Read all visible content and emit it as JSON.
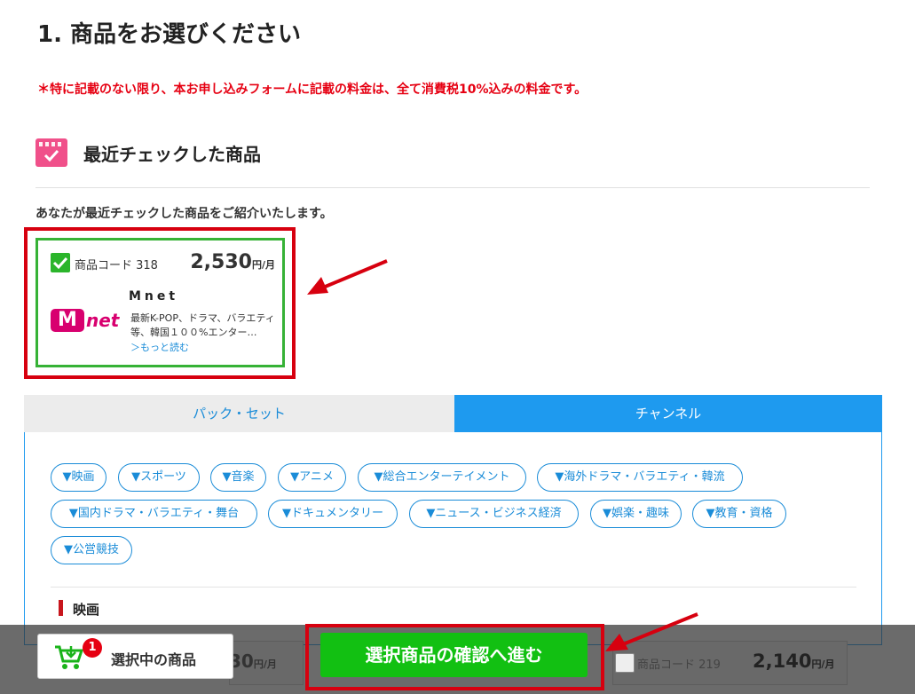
{
  "heading": {
    "step_title": "1. 商品をお選びください"
  },
  "notice": "＊特に記載のない限り、本お申し込みフォームに記載の料金は、全て消費税10%込みの料金です。",
  "recent": {
    "title": "最近チェックした商品",
    "description": "あなたが最近チェックした商品をご紹介いたします。",
    "item": {
      "checked": true,
      "code_label": "商品コード 318",
      "price": "2,530",
      "price_unit": "円/月",
      "name": "Mnet",
      "logo_text_m": "M",
      "logo_text_net": "net",
      "description": "最新K-POP、ドラマ、バラエティ等、韓国１００%エンター…",
      "more_link": "＞もっと読む"
    }
  },
  "tabs": [
    {
      "label": "パック・セット",
      "active": false
    },
    {
      "label": "チャンネル",
      "active": true
    }
  ],
  "genre_chips": [
    "▼映画",
    "▼スポーツ",
    "▼音楽",
    "▼アニメ",
    "▼総合エンターテイメント",
    "▼海外ドラマ・バラエティ・韓流",
    "▼国内ドラマ・バラエティ・舞台",
    "▼ドキュメンタリー",
    "▼ニュース・ビジネス経済",
    "▼娯楽・趣味",
    "▼教育・資格",
    "▼公営競技"
  ],
  "section": {
    "title": "映画"
  },
  "partial_cards": [
    {
      "price": "30",
      "price_unit": "円/月"
    },
    {
      "code_label": "商品コード 219",
      "price": "2,140",
      "price_unit": "円/月"
    }
  ],
  "bottom_bar": {
    "cart_label": "選択中の商品",
    "cart_count": "1",
    "confirm_label": "選択商品の確認へ進む"
  },
  "colors": {
    "accent_blue": "#1e9aef",
    "alert_red": "#e60012",
    "confirm_green": "#12c012",
    "check_green": "#2bb52b",
    "mnet_magenta": "#d8006f",
    "badge_pink": "#f0508a"
  },
  "icons": {
    "recent_badge": "calendar-check-icon",
    "item_checkbox": "checkbox-checked-icon",
    "cart": "cart-download-icon",
    "annotation": "red-arrow-icon"
  }
}
